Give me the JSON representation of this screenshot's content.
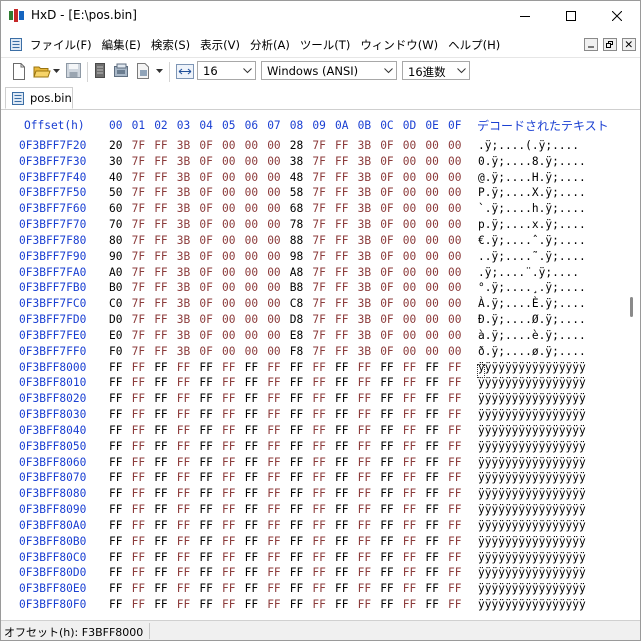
{
  "window": {
    "title": "HxD - [E:\\pos.bin]"
  },
  "menu": {
    "items": [
      "ファイル(F)",
      "編集(E)",
      "検索(S)",
      "表示(V)",
      "分析(A)",
      "ツール(T)",
      "ウィンドウ(W)",
      "ヘルプ(H)"
    ]
  },
  "toolbar": {
    "bytes_per_row": "16",
    "charset": "Windows (ANSI)",
    "offset_base": "16進数"
  },
  "tab": {
    "label": "pos.bin"
  },
  "hex": {
    "offset_header": "Offset(h)",
    "column_headers": [
      "00",
      "01",
      "02",
      "03",
      "04",
      "05",
      "06",
      "07",
      "08",
      "09",
      "0A",
      "0B",
      "0C",
      "0D",
      "0E",
      "0F"
    ],
    "decoded_header": "デコードされたテキスト",
    "rows": [
      {
        "offset": "0F3BFF7F20",
        "bytes": [
          "20",
          "7F",
          "FF",
          "3B",
          "0F",
          "00",
          "00",
          "00",
          "28",
          "7F",
          "FF",
          "3B",
          "0F",
          "00",
          "00",
          "00"
        ],
        "text": " .ÿ;....(.ÿ;...."
      },
      {
        "offset": "0F3BFF7F30",
        "bytes": [
          "30",
          "7F",
          "FF",
          "3B",
          "0F",
          "00",
          "00",
          "00",
          "38",
          "7F",
          "FF",
          "3B",
          "0F",
          "00",
          "00",
          "00"
        ],
        "text": "0.ÿ;....8.ÿ;...."
      },
      {
        "offset": "0F3BFF7F40",
        "bytes": [
          "40",
          "7F",
          "FF",
          "3B",
          "0F",
          "00",
          "00",
          "00",
          "48",
          "7F",
          "FF",
          "3B",
          "0F",
          "00",
          "00",
          "00"
        ],
        "text": "@.ÿ;....H.ÿ;...."
      },
      {
        "offset": "0F3BFF7F50",
        "bytes": [
          "50",
          "7F",
          "FF",
          "3B",
          "0F",
          "00",
          "00",
          "00",
          "58",
          "7F",
          "FF",
          "3B",
          "0F",
          "00",
          "00",
          "00"
        ],
        "text": "P.ÿ;....X.ÿ;...."
      },
      {
        "offset": "0F3BFF7F60",
        "bytes": [
          "60",
          "7F",
          "FF",
          "3B",
          "0F",
          "00",
          "00",
          "00",
          "68",
          "7F",
          "FF",
          "3B",
          "0F",
          "00",
          "00",
          "00"
        ],
        "text": "`.ÿ;....h.ÿ;...."
      },
      {
        "offset": "0F3BFF7F70",
        "bytes": [
          "70",
          "7F",
          "FF",
          "3B",
          "0F",
          "00",
          "00",
          "00",
          "78",
          "7F",
          "FF",
          "3B",
          "0F",
          "00",
          "00",
          "00"
        ],
        "text": "p.ÿ;....x.ÿ;...."
      },
      {
        "offset": "0F3BFF7F80",
        "bytes": [
          "80",
          "7F",
          "FF",
          "3B",
          "0F",
          "00",
          "00",
          "00",
          "88",
          "7F",
          "FF",
          "3B",
          "0F",
          "00",
          "00",
          "00"
        ],
        "text": "€.ÿ;....ˆ.ÿ;...."
      },
      {
        "offset": "0F3BFF7F90",
        "bytes": [
          "90",
          "7F",
          "FF",
          "3B",
          "0F",
          "00",
          "00",
          "00",
          "98",
          "7F",
          "FF",
          "3B",
          "0F",
          "00",
          "00",
          "00"
        ],
        "text": "..ÿ;....˜.ÿ;...."
      },
      {
        "offset": "0F3BFF7FA0",
        "bytes": [
          "A0",
          "7F",
          "FF",
          "3B",
          "0F",
          "00",
          "00",
          "00",
          "A8",
          "7F",
          "FF",
          "3B",
          "0F",
          "00",
          "00",
          "00"
        ],
        "text": " .ÿ;....¨.ÿ;...."
      },
      {
        "offset": "0F3BFF7FB0",
        "bytes": [
          "B0",
          "7F",
          "FF",
          "3B",
          "0F",
          "00",
          "00",
          "00",
          "B8",
          "7F",
          "FF",
          "3B",
          "0F",
          "00",
          "00",
          "00"
        ],
        "text": "°.ÿ;....¸.ÿ;...."
      },
      {
        "offset": "0F3BFF7FC0",
        "bytes": [
          "C0",
          "7F",
          "FF",
          "3B",
          "0F",
          "00",
          "00",
          "00",
          "C8",
          "7F",
          "FF",
          "3B",
          "0F",
          "00",
          "00",
          "00"
        ],
        "text": "À.ÿ;....È.ÿ;...."
      },
      {
        "offset": "0F3BFF7FD0",
        "bytes": [
          "D0",
          "7F",
          "FF",
          "3B",
          "0F",
          "00",
          "00",
          "00",
          "D8",
          "7F",
          "FF",
          "3B",
          "0F",
          "00",
          "00",
          "00"
        ],
        "text": "Ð.ÿ;....Ø.ÿ;...."
      },
      {
        "offset": "0F3BFF7FE0",
        "bytes": [
          "E0",
          "7F",
          "FF",
          "3B",
          "0F",
          "00",
          "00",
          "00",
          "E8",
          "7F",
          "FF",
          "3B",
          "0F",
          "00",
          "00",
          "00"
        ],
        "text": "à.ÿ;....è.ÿ;...."
      },
      {
        "offset": "0F3BFF7FF0",
        "bytes": [
          "F0",
          "7F",
          "FF",
          "3B",
          "0F",
          "00",
          "00",
          "00",
          "F8",
          "7F",
          "FF",
          "3B",
          "0F",
          "00",
          "00",
          "00"
        ],
        "text": "ð.ÿ;....ø.ÿ;...."
      },
      {
        "offset": "0F3BFF8000",
        "bytes": [
          "FF",
          "FF",
          "FF",
          "FF",
          "FF",
          "FF",
          "FF",
          "FF",
          "FF",
          "FF",
          "FF",
          "FF",
          "FF",
          "FF",
          "FF",
          "FF"
        ],
        "text": "ÿÿÿÿÿÿÿÿÿÿÿÿÿÿÿÿ"
      },
      {
        "offset": "0F3BFF8010",
        "bytes": [
          "FF",
          "FF",
          "FF",
          "FF",
          "FF",
          "FF",
          "FF",
          "FF",
          "FF",
          "FF",
          "FF",
          "FF",
          "FF",
          "FF",
          "FF",
          "FF"
        ],
        "text": "ÿÿÿÿÿÿÿÿÿÿÿÿÿÿÿÿ"
      },
      {
        "offset": "0F3BFF8020",
        "bytes": [
          "FF",
          "FF",
          "FF",
          "FF",
          "FF",
          "FF",
          "FF",
          "FF",
          "FF",
          "FF",
          "FF",
          "FF",
          "FF",
          "FF",
          "FF",
          "FF"
        ],
        "text": "ÿÿÿÿÿÿÿÿÿÿÿÿÿÿÿÿ"
      },
      {
        "offset": "0F3BFF8030",
        "bytes": [
          "FF",
          "FF",
          "FF",
          "FF",
          "FF",
          "FF",
          "FF",
          "FF",
          "FF",
          "FF",
          "FF",
          "FF",
          "FF",
          "FF",
          "FF",
          "FF"
        ],
        "text": "ÿÿÿÿÿÿÿÿÿÿÿÿÿÿÿÿ"
      },
      {
        "offset": "0F3BFF8040",
        "bytes": [
          "FF",
          "FF",
          "FF",
          "FF",
          "FF",
          "FF",
          "FF",
          "FF",
          "FF",
          "FF",
          "FF",
          "FF",
          "FF",
          "FF",
          "FF",
          "FF"
        ],
        "text": "ÿÿÿÿÿÿÿÿÿÿÿÿÿÿÿÿ"
      },
      {
        "offset": "0F3BFF8050",
        "bytes": [
          "FF",
          "FF",
          "FF",
          "FF",
          "FF",
          "FF",
          "FF",
          "FF",
          "FF",
          "FF",
          "FF",
          "FF",
          "FF",
          "FF",
          "FF",
          "FF"
        ],
        "text": "ÿÿÿÿÿÿÿÿÿÿÿÿÿÿÿÿ"
      },
      {
        "offset": "0F3BFF8060",
        "bytes": [
          "FF",
          "FF",
          "FF",
          "FF",
          "FF",
          "FF",
          "FF",
          "FF",
          "FF",
          "FF",
          "FF",
          "FF",
          "FF",
          "FF",
          "FF",
          "FF"
        ],
        "text": "ÿÿÿÿÿÿÿÿÿÿÿÿÿÿÿÿ"
      },
      {
        "offset": "0F3BFF8070",
        "bytes": [
          "FF",
          "FF",
          "FF",
          "FF",
          "FF",
          "FF",
          "FF",
          "FF",
          "FF",
          "FF",
          "FF",
          "FF",
          "FF",
          "FF",
          "FF",
          "FF"
        ],
        "text": "ÿÿÿÿÿÿÿÿÿÿÿÿÿÿÿÿ"
      },
      {
        "offset": "0F3BFF8080",
        "bytes": [
          "FF",
          "FF",
          "FF",
          "FF",
          "FF",
          "FF",
          "FF",
          "FF",
          "FF",
          "FF",
          "FF",
          "FF",
          "FF",
          "FF",
          "FF",
          "FF"
        ],
        "text": "ÿÿÿÿÿÿÿÿÿÿÿÿÿÿÿÿ"
      },
      {
        "offset": "0F3BFF8090",
        "bytes": [
          "FF",
          "FF",
          "FF",
          "FF",
          "FF",
          "FF",
          "FF",
          "FF",
          "FF",
          "FF",
          "FF",
          "FF",
          "FF",
          "FF",
          "FF",
          "FF"
        ],
        "text": "ÿÿÿÿÿÿÿÿÿÿÿÿÿÿÿÿ"
      },
      {
        "offset": "0F3BFF80A0",
        "bytes": [
          "FF",
          "FF",
          "FF",
          "FF",
          "FF",
          "FF",
          "FF",
          "FF",
          "FF",
          "FF",
          "FF",
          "FF",
          "FF",
          "FF",
          "FF",
          "FF"
        ],
        "text": "ÿÿÿÿÿÿÿÿÿÿÿÿÿÿÿÿ"
      },
      {
        "offset": "0F3BFF80B0",
        "bytes": [
          "FF",
          "FF",
          "FF",
          "FF",
          "FF",
          "FF",
          "FF",
          "FF",
          "FF",
          "FF",
          "FF",
          "FF",
          "FF",
          "FF",
          "FF",
          "FF"
        ],
        "text": "ÿÿÿÿÿÿÿÿÿÿÿÿÿÿÿÿ"
      },
      {
        "offset": "0F3BFF80C0",
        "bytes": [
          "FF",
          "FF",
          "FF",
          "FF",
          "FF",
          "FF",
          "FF",
          "FF",
          "FF",
          "FF",
          "FF",
          "FF",
          "FF",
          "FF",
          "FF",
          "FF"
        ],
        "text": "ÿÿÿÿÿÿÿÿÿÿÿÿÿÿÿÿ"
      },
      {
        "offset": "0F3BFF80D0",
        "bytes": [
          "FF",
          "FF",
          "FF",
          "FF",
          "FF",
          "FF",
          "FF",
          "FF",
          "FF",
          "FF",
          "FF",
          "FF",
          "FF",
          "FF",
          "FF",
          "FF"
        ],
        "text": "ÿÿÿÿÿÿÿÿÿÿÿÿÿÿÿÿ"
      },
      {
        "offset": "0F3BFF80E0",
        "bytes": [
          "FF",
          "FF",
          "FF",
          "FF",
          "FF",
          "FF",
          "FF",
          "FF",
          "FF",
          "FF",
          "FF",
          "FF",
          "FF",
          "FF",
          "FF",
          "FF"
        ],
        "text": "ÿÿÿÿÿÿÿÿÿÿÿÿÿÿÿÿ"
      },
      {
        "offset": "0F3BFF80F0",
        "bytes": [
          "FF",
          "FF",
          "FF",
          "FF",
          "FF",
          "FF",
          "FF",
          "FF",
          "FF",
          "FF",
          "FF",
          "FF",
          "FF",
          "FF",
          "FF",
          "FF"
        ],
        "text": "ÿÿÿÿÿÿÿÿÿÿÿÿÿÿÿÿ"
      }
    ]
  },
  "status": {
    "offset": "オフセット(h): F3BFF8000"
  },
  "colors": {
    "offset_blue": "#1a3fd2",
    "zero_byte": "#8b3a3a"
  }
}
